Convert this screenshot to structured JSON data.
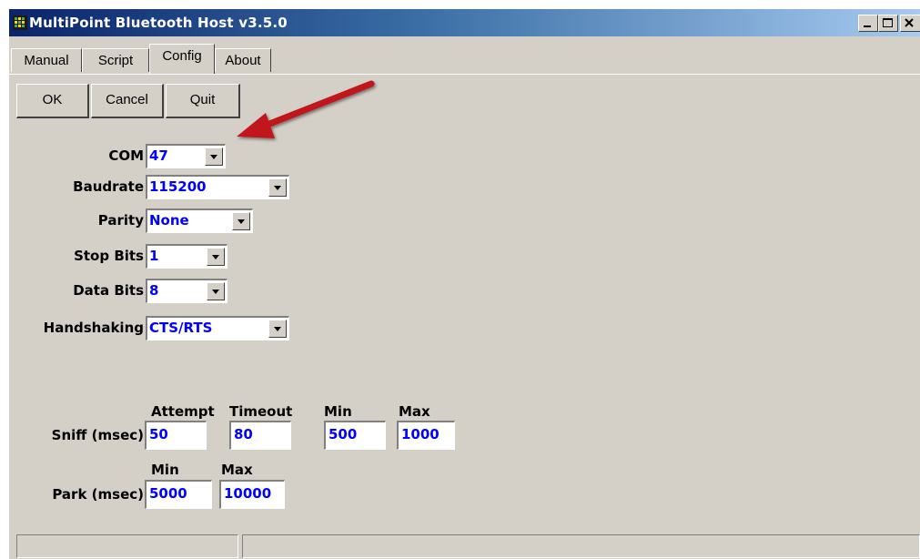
{
  "window": {
    "title": "MultiPoint Bluetooth Host v3.5.0"
  },
  "tabs": [
    {
      "label": "Manual"
    },
    {
      "label": "Script"
    },
    {
      "label": "Config"
    },
    {
      "label": "About"
    }
  ],
  "active_tab": "Config",
  "buttons": {
    "ok": "OK",
    "cancel": "Cancel",
    "quit": "Quit"
  },
  "serial": {
    "com": {
      "label": "COM",
      "value": "47"
    },
    "baudrate": {
      "label": "Baudrate",
      "value": "115200"
    },
    "parity": {
      "label": "Parity",
      "value": "None"
    },
    "stop_bits": {
      "label": "Stop Bits",
      "value": "1"
    },
    "data_bits": {
      "label": "Data Bits",
      "value": "8"
    },
    "handshaking": {
      "label": "Handshaking",
      "value": "CTS/RTS"
    }
  },
  "sniff": {
    "label": "Sniff (msec)",
    "headers": {
      "attempt": "Attempt",
      "timeout": "Timeout",
      "min": "Min",
      "max": "Max"
    },
    "values": {
      "attempt": "50",
      "timeout": "80",
      "min": "500",
      "max": "1000"
    }
  },
  "park": {
    "label": "Park (msec)",
    "headers": {
      "min": "Min",
      "max": "Max"
    },
    "values": {
      "min": "5000",
      "max": "10000"
    }
  },
  "colors": {
    "field_text": "#0000ff",
    "annotation_arrow": "#c0141a",
    "face": "#d4d0c8"
  }
}
